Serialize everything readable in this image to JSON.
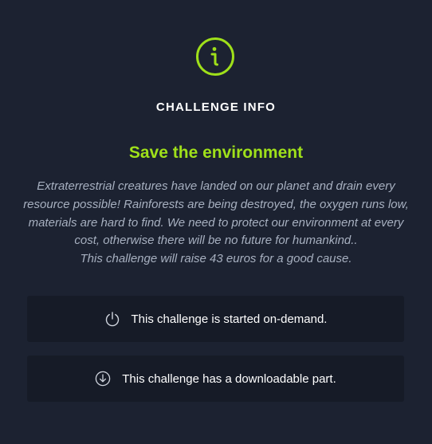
{
  "header": {
    "heading": "CHALLENGE INFO",
    "icon": "info-icon"
  },
  "challenge": {
    "title": "Save the environment",
    "description": "Extraterrestrial creatures have landed on our planet and drain every resource possible! Rainforests are being destroyed, the oxygen runs low, materials are hard to find. We need to protect our environment at every cost, otherwise there will be no future for humankind..",
    "donation": "This challenge will raise 43 euros for a good cause."
  },
  "features": [
    {
      "icon": "power-icon",
      "text": "This challenge is started on-demand."
    },
    {
      "icon": "download-icon",
      "text": "This challenge has a downloadable part."
    }
  ],
  "colors": {
    "background": "#1c2231",
    "accent": "#9fe01a",
    "card": "#161b27",
    "muted_text": "#a7b0c0"
  }
}
